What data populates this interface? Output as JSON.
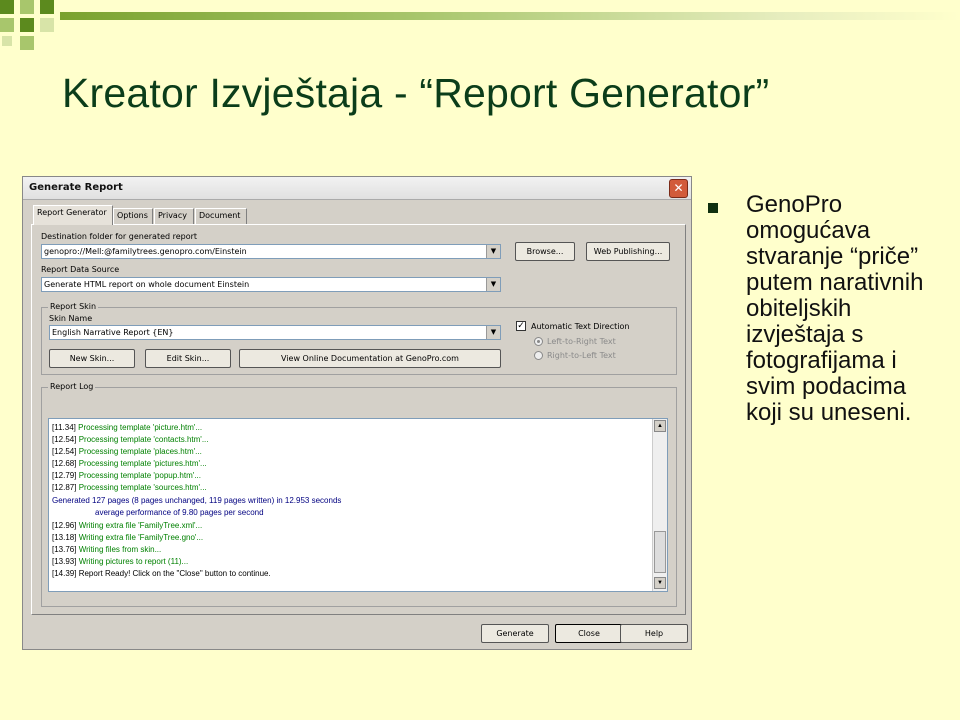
{
  "slide": {
    "title": "Kreator Izvještaja - “Report Generator”",
    "bullet": "GenoPro omogućava stvaranje “priče” putem narativnih obiteljskih izvještaja s fotografijama i svim podacima koji su uneseni.",
    "colors": {
      "background": "#ffffcc",
      "title": "#0b3d1a",
      "accent": "#7aa22e"
    }
  },
  "dialog": {
    "title": "Generate Report",
    "close_icon": "close-icon",
    "tabs": [
      {
        "label": "Report Generator",
        "active": true
      },
      {
        "label": "Options",
        "active": false
      },
      {
        "label": "Privacy",
        "active": false
      },
      {
        "label": "Document",
        "active": false
      }
    ],
    "destination": {
      "label": "Destination folder for generated report",
      "value": "genopro://Mell:@familytrees.genopro.com/Einstein",
      "browse_label": "Browse...",
      "web_publishing_label": "Web Publishing..."
    },
    "source": {
      "label": "Report Data Source",
      "value": "Generate HTML report on whole document Einstein"
    },
    "skin": {
      "group_label": "Report Skin",
      "name_label": "Skin Name",
      "value": "English Narrative Report  {EN}",
      "new_label": "New Skin...",
      "edit_label": "Edit Skin...",
      "docs_label": "View Online Documentation at GenoPro.com",
      "auto_direction_label": "Automatic Text Direction",
      "auto_direction_checked": true,
      "ltr_label": "Left-to-Right Text",
      "rtl_label": "Right-to-Left Text"
    },
    "log": {
      "group_label": "Report Log",
      "lines": [
        {
          "ts": "[11.34]",
          "text": "Processing template 'picture.htm'...",
          "style": "green"
        },
        {
          "ts": "[12.54]",
          "text": "Processing template 'contacts.htm'...",
          "style": "green"
        },
        {
          "ts": "[12.54]",
          "text": "Processing template 'places.htm'...",
          "style": "green"
        },
        {
          "ts": "[12.68]",
          "text": "Processing template 'pictures.htm'...",
          "style": "green"
        },
        {
          "ts": "[12.79]",
          "text": "Processing template 'popup.htm'...",
          "style": "green"
        },
        {
          "ts": "[12.87]",
          "text": "Processing template 'sources.htm'...",
          "style": "green"
        },
        {
          "ts": "",
          "text": "Generated 127 pages (8 pages unchanged, 119 pages written) in 12.953 seconds",
          "style": "blue"
        },
        {
          "ts": "",
          "text": "average performance of 9.80 pages per second",
          "style": "blue"
        },
        {
          "ts": "[12.96]",
          "text": "Writing extra file 'FamilyTree.xml'...",
          "style": "green"
        },
        {
          "ts": "[13.18]",
          "text": "Writing extra file 'FamilyTree.gno'...",
          "style": "green"
        },
        {
          "ts": "[13.76]",
          "text": "Writing files from skin...",
          "style": "green"
        },
        {
          "ts": "[13.93]",
          "text": "Writing pictures to report (11)...",
          "style": "green"
        },
        {
          "ts": "[14.39]",
          "text": "Report Ready!  Click on the \"Close\" button to continue.",
          "style": "black"
        }
      ]
    },
    "footer": {
      "generate_label": "Generate",
      "close_label": "Close",
      "help_label": "Help"
    }
  }
}
